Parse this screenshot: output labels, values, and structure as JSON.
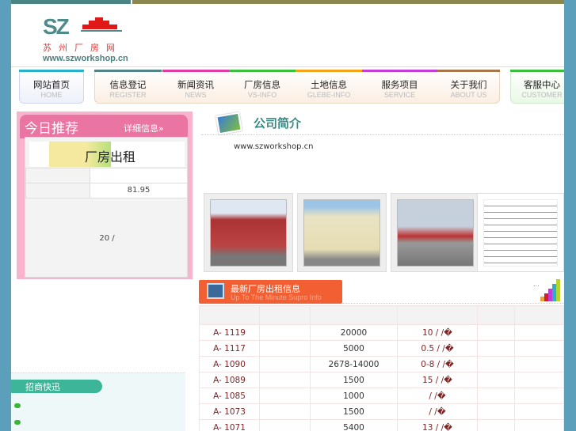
{
  "logo": {
    "mark": "SZ",
    "name_cn": "苏州厂房网",
    "url": "www.szworkshop.cn"
  },
  "nav": [
    {
      "zh": "网站首页",
      "en": "HOME",
      "color": "#27b1cc"
    },
    {
      "zh": "信息登记",
      "en": "REGISTER",
      "color": "#4f8582"
    },
    {
      "zh": "新闻资讯",
      "en": "NEWS",
      "color": "#e03aa4"
    },
    {
      "zh": "厂房信息",
      "en": "VS-INFO",
      "color": "#3cbf3c"
    },
    {
      "zh": "土地信息",
      "en": "GLEBE-INFO",
      "color": "#f7a21b"
    },
    {
      "zh": "服务项目",
      "en": "SERVICE",
      "color": "#c43bd8"
    },
    {
      "zh": "关于我们",
      "en": "ABOUT US",
      "color": "#a8754a"
    },
    {
      "zh": "客服中心",
      "en": "CUSTOMER",
      "color": "#3cbf3c"
    }
  ],
  "today": {
    "title": "今日推荐",
    "more": "详细信息»",
    "banner": "厂房出租",
    "row1": [
      "",
      ""
    ],
    "row2": [
      "",
      "81.95"
    ],
    "body": "20 /"
  },
  "intro": {
    "title": "公司简介",
    "url": "www.szworkshop.cn"
  },
  "rent": {
    "title": "最新厂房出租信息",
    "subtitle": "Up To The Minute Supro Info",
    "more": "...",
    "rows": [
      {
        "code": "A- 1119",
        "area": "20000",
        "price": "10 / /�"
      },
      {
        "code": "A- 1117",
        "area": "5000",
        "price": "0.5 / /�"
      },
      {
        "code": "A- 1090",
        "area": "2678-14000",
        "price": "0-8 / /�"
      },
      {
        "code": "A- 1089",
        "area": "1500",
        "price": "15 / /�"
      },
      {
        "code": "A- 1085",
        "area": "1000",
        "price": "/ /�"
      },
      {
        "code": "A- 1073",
        "area": "1500",
        "price": "/ /�"
      },
      {
        "code": "A- 1071",
        "area": "5400",
        "price": "13 / /�"
      }
    ]
  },
  "news": {
    "title": "招商快迅"
  }
}
